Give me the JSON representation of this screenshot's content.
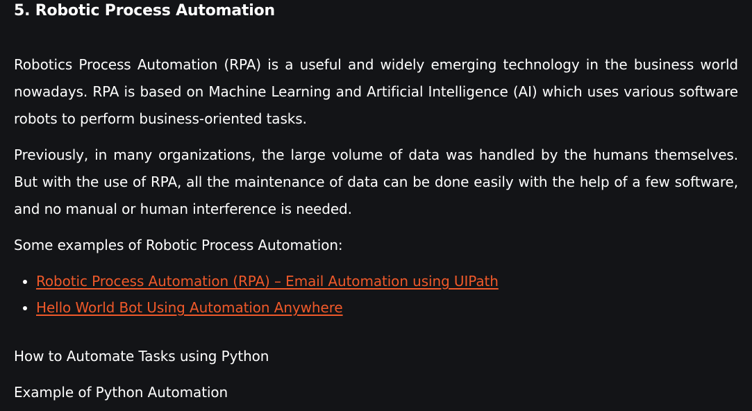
{
  "article": {
    "heading": "5. Robotic Process Automation",
    "paragraphs": [
      "Robotics Process Automation (RPA) is a useful and widely emerging technology in the business world nowadays. RPA is based on Machine Learning and Artificial Intelligence (AI) which uses various software robots to perform business-oriented tasks.",
      "Previously, in many organizations, the large volume of data was handled by the humans themselves. But with the use of RPA, all the maintenance of data can be done easily with the help of a few software, and no manual or human interference is needed."
    ],
    "examples_intro": "Some examples of Robotic Process Automation:",
    "examples": [
      {
        "label": "Robotic Process Automation (RPA) – Email Automation using UIPath"
      },
      {
        "label": "Hello World Bot Using Automation Anywhere"
      }
    ],
    "related": [
      "How to Automate Tasks using Python",
      "Example of Python Automation"
    ]
  },
  "colors": {
    "background": "#131417",
    "text": "#ffffff",
    "link": "#f0592a"
  }
}
